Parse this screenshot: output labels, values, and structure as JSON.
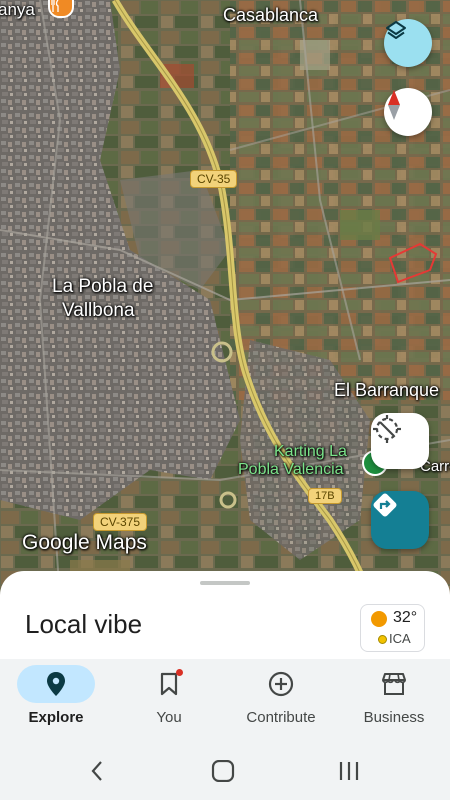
{
  "map": {
    "labels": {
      "partial_top_left": "anya",
      "casablanca": "Casablanca",
      "la_pobla_line1": "La Pobla de",
      "la_pobla_line2": "Vallbona",
      "el_barranquet": "El Barranque",
      "karting_line1": "Karting La",
      "karting_line2": "Pobla Valencia",
      "street_partial": "Carre",
      "watermark": "Google Maps"
    },
    "road_shields": {
      "cv35": "CV-35",
      "cv375": "CV-375",
      "exit17b": "17B"
    },
    "controls": {
      "layers_icon": "layers-icon",
      "compass_icon": "compass-icon",
      "location_icon": "location-disabled-icon",
      "directions_icon": "directions-icon"
    },
    "colors": {
      "layers_bg": "#9be0f0",
      "directions_bg": "#147f94",
      "highway": "#d8c76a",
      "compass_red": "#d93025"
    }
  },
  "sheet": {
    "title": "Local vibe",
    "weather": {
      "temp": "32°",
      "aqi": "ICA",
      "sun_color": "#f29900",
      "aqi_dot_color": "#f2c200"
    }
  },
  "nav": {
    "items": [
      {
        "label": "Explore",
        "icon": "place-icon",
        "active": true
      },
      {
        "label": "You",
        "icon": "bookmark-icon",
        "badge": true
      },
      {
        "label": "Contribute",
        "icon": "add-circle-icon"
      },
      {
        "label": "Business",
        "icon": "store-icon"
      }
    ],
    "active_bg": "#c2e7ff",
    "badge_color": "#d93025"
  },
  "system_nav": {
    "back": "back-icon",
    "home": "home-icon",
    "recents": "recents-icon"
  }
}
